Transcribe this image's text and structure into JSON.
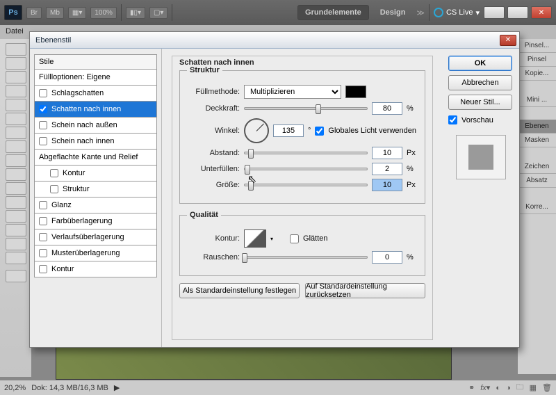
{
  "toolbar": {
    "logo": "Ps",
    "br": "Br",
    "mb": "Mb",
    "zoom": "100%",
    "ws_active": "Grundelemente",
    "ws_other": "Design",
    "more": "≫",
    "cslive": "CS Live"
  },
  "menu": {
    "file": "Datei"
  },
  "dialog": {
    "title": "Ebenenstil",
    "styles_header": "Stile",
    "items": {
      "blend": "Füllloptionen: Eigene",
      "drop_shadow": "Schlagschatten",
      "inner_shadow": "Schatten nach innen",
      "outer_glow": "Schein nach außen",
      "inner_glow": "Schein nach innen",
      "bevel": "Abgeflachte Kante und Relief",
      "contour_sub": "Kontur",
      "texture_sub": "Struktur",
      "satin": "Glanz",
      "color_overlay": "Farbüberlagerung",
      "grad_overlay": "Verlaufsüberlagerung",
      "pattern_overlay": "Musterüberlagerung",
      "stroke": "Kontur"
    },
    "section": "Schatten nach innen",
    "struct": "Struktur",
    "fill_mode_lbl": "Füllmethode:",
    "fill_mode_val": "Multiplizieren",
    "opacity_lbl": "Deckkraft:",
    "opacity_val": "80",
    "angle_lbl": "Winkel:",
    "angle_val": "135",
    "angle_deg": "°",
    "global_light": "Globales Licht verwenden",
    "distance_lbl": "Abstand:",
    "distance_val": "10",
    "px": "Px",
    "choke_lbl": "Unterfüllen:",
    "choke_val": "2",
    "pct": "%",
    "size_lbl": "Größe:",
    "size_val": "10",
    "quality": "Qualität",
    "contour_lbl": "Kontur:",
    "antialias": "Glätten",
    "noise_lbl": "Rauschen:",
    "noise_val": "0",
    "set_default": "Als Standardeinstellung festlegen",
    "reset_default": "Auf Standardeinstellung zurücksetzen",
    "ok": "OK",
    "cancel": "Abbrechen",
    "new_style": "Neuer Stil...",
    "preview": "Vorschau"
  },
  "panels": {
    "brush": "Pinsel...",
    "brush2": "Pinsel",
    "clone": "Kopie...",
    "mini": "Mini ...",
    "layers": "Ebenen",
    "masks": "Masken",
    "chars": "Zeichen",
    "para": "Absatz",
    "corr": "Korre..."
  },
  "status": {
    "zoom": "20,2%",
    "doc": "Dok: 14,3 MB/16,3 MB"
  }
}
